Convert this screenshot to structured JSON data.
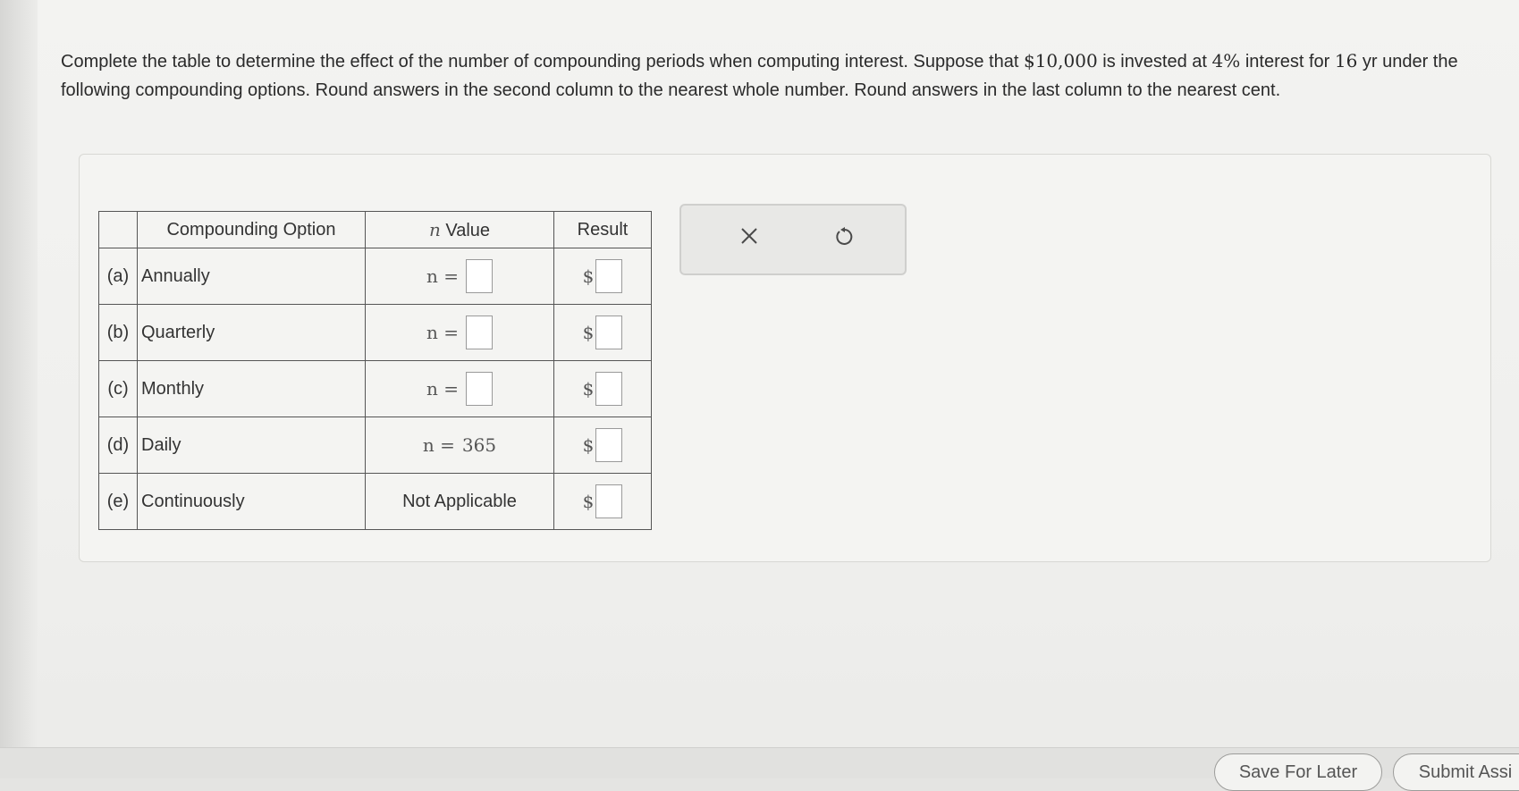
{
  "question": {
    "p1": "Complete the table to determine the effect of the number of compounding periods when computing interest. Suppose that ",
    "principal": "$10,000",
    "p2": " is invested at ",
    "rate": "4%",
    "p3": " interest for ",
    "time": "16",
    "p4": " yr under the following compounding options. Round answers in the second column to the nearest whole number. Round answers in the last column to the nearest cent."
  },
  "table": {
    "headers": [
      "",
      "Compounding Option",
      "n Value",
      "Result"
    ],
    "header_n_var": "n",
    "header_n_text": " Value",
    "rows": [
      {
        "letter": "(a)",
        "option": "Annually",
        "n_prefix": "n =",
        "n_value": "",
        "result_prefix": "$"
      },
      {
        "letter": "(b)",
        "option": "Quarterly",
        "n_prefix": "n =",
        "n_value": "",
        "result_prefix": "$"
      },
      {
        "letter": "(c)",
        "option": "Monthly",
        "n_prefix": "n =",
        "n_value": "",
        "result_prefix": "$"
      },
      {
        "letter": "(d)",
        "option": "Daily",
        "n_prefix": "n =",
        "n_value": "365",
        "result_prefix": "$"
      },
      {
        "letter": "(e)",
        "option": "Continuously",
        "n_text": "Not Applicable",
        "result_prefix": "$"
      }
    ]
  },
  "tools": {
    "clear_icon": "close-icon",
    "reset_icon": "undo-icon"
  },
  "footer": {
    "save_label": "Save For Later",
    "submit_label": "Submit Assi"
  }
}
